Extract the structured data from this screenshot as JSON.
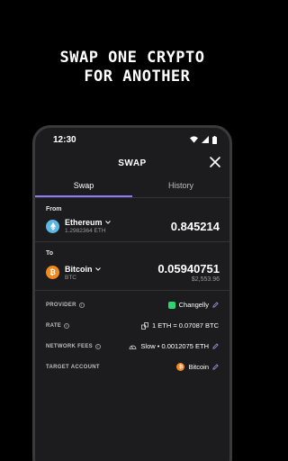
{
  "headline": {
    "line1": "SWAP ONE CRYPTO",
    "line2": " FOR ANOTHER"
  },
  "status": {
    "time": "12:30"
  },
  "screen": {
    "title": "SWAP"
  },
  "tabs": [
    {
      "label": "Swap",
      "active": true
    },
    {
      "label": "History",
      "active": false
    }
  ],
  "from": {
    "label": "From",
    "asset": "Ethereum",
    "balance": "1.2982364 ETH",
    "amount": "0.845214",
    "icon": "ethereum-icon"
  },
  "to": {
    "label": "To",
    "asset": "Bitcoin",
    "ticker": "BTC",
    "amount": "0.05940751",
    "fiat": "$2,553.96",
    "icon": "bitcoin-icon"
  },
  "details": {
    "provider": {
      "label": "PROVIDER",
      "value": "Changelly"
    },
    "rate": {
      "label": "RATE",
      "value": "1 ETH = 0.07087 BTC"
    },
    "fees": {
      "label": "NETWORK FEES",
      "value": "Slow • 0.0012075 ETH"
    },
    "target": {
      "label": "TARGET ACCOUNT",
      "value": "Bitcoin"
    }
  },
  "colors": {
    "accent": "#8b7cf6",
    "eth": "#5ab7e6",
    "btc": "#f2891c",
    "changelly": "#2fd36f"
  }
}
